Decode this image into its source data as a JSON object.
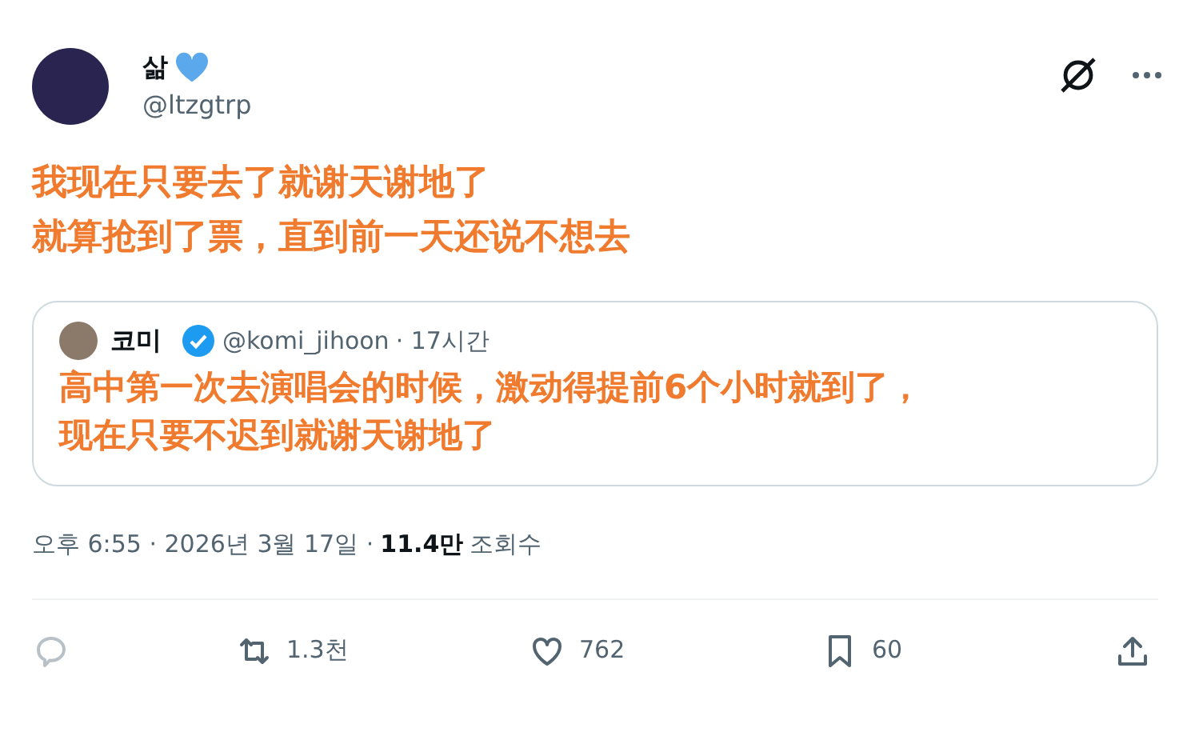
{
  "tweet": {
    "name": "삶",
    "handle": "@ltzgtrp",
    "lines": [
      "我现在只要去了就谢天谢地了",
      "就算抢到了票，直到前一天还说不想去"
    ]
  },
  "quote": {
    "name": "코미",
    "verified": true,
    "handle": "@komi_jihoon",
    "time": "· 17시간",
    "lines": [
      "高中第一次去演唱会的时候，激动得提前6个小时就到了，",
      "现在只要不迟到就谢天谢地了"
    ]
  },
  "meta": {
    "time": "오후 6:55 · 2026년 3월 17일 ·",
    "views": "11.4만",
    "views_label": "조회수"
  },
  "actions": [
    {
      "kind": "reply"
    },
    {
      "kind": "repost",
      "count": "1.3천"
    },
    {
      "kind": "like",
      "count": "762"
    },
    {
      "kind": "bookmark",
      "count": "60"
    },
    {
      "kind": "share"
    }
  ]
}
